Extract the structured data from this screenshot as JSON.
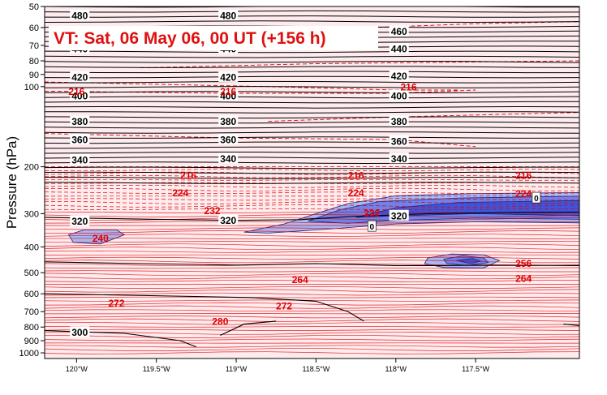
{
  "chart_data": {
    "type": "contour",
    "title": "VT:  Sat, 06 May 06, 00 UT (+156 h)",
    "ylabel": "Pressure (hPa)",
    "xlabel": "",
    "y_scale": "log",
    "y_inverted": true,
    "ylim": [
      50,
      1050
    ],
    "xlim": [
      -120.2,
      -116.85
    ],
    "y_ticks": [
      50,
      60,
      70,
      80,
      90,
      100,
      200,
      300,
      400,
      500,
      600,
      700,
      800,
      900,
      1000
    ],
    "x_ticks": [
      {
        "value": -120.0,
        "label": "120°W"
      },
      {
        "value": -119.5,
        "label": "119.5°W"
      },
      {
        "value": -119.0,
        "label": "119°W"
      },
      {
        "value": -118.5,
        "label": "118.5°W"
      },
      {
        "value": -118.0,
        "label": "118°W"
      },
      {
        "value": -117.5,
        "label": "117.5°W"
      }
    ],
    "theta_labels": [
      {
        "text": "480",
        "x": -119.98,
        "p": 54
      },
      {
        "text": "480",
        "x": -119.05,
        "p": 54
      },
      {
        "text": "460",
        "x": -117.98,
        "p": 62
      },
      {
        "text": "440",
        "x": -119.98,
        "p": 72
      },
      {
        "text": "440",
        "x": -119.05,
        "p": 72
      },
      {
        "text": "440",
        "x": -117.98,
        "p": 72
      },
      {
        "text": "420",
        "x": -119.98,
        "p": 92
      },
      {
        "text": "420",
        "x": -119.05,
        "p": 92
      },
      {
        "text": "420",
        "x": -117.98,
        "p": 91
      },
      {
        "text": "400",
        "x": -119.98,
        "p": 108
      },
      {
        "text": "400",
        "x": -119.05,
        "p": 108
      },
      {
        "text": "400",
        "x": -117.98,
        "p": 108
      },
      {
        "text": "380",
        "x": -119.98,
        "p": 135
      },
      {
        "text": "380",
        "x": -119.05,
        "p": 135
      },
      {
        "text": "380",
        "x": -117.98,
        "p": 135
      },
      {
        "text": "360",
        "x": -119.98,
        "p": 158
      },
      {
        "text": "360",
        "x": -119.05,
        "p": 158
      },
      {
        "text": "360",
        "x": -117.98,
        "p": 160
      },
      {
        "text": "340",
        "x": -119.98,
        "p": 188
      },
      {
        "text": "340",
        "x": -119.05,
        "p": 186
      },
      {
        "text": "340",
        "x": -117.98,
        "p": 186
      },
      {
        "text": "320",
        "x": -119.98,
        "p": 320
      },
      {
        "text": "320",
        "x": -119.05,
        "p": 318
      },
      {
        "text": "320",
        "x": -117.98,
        "p": 305
      },
      {
        "text": "300",
        "x": -119.98,
        "p": 835
      }
    ],
    "temp_labels": [
      {
        "text": "216",
        "x": -120.0,
        "p": 104
      },
      {
        "text": "216",
        "x": -119.05,
        "p": 104
      },
      {
        "text": "216",
        "x": -117.92,
        "p": 100
      },
      {
        "text": "216",
        "x": -119.3,
        "p": 215
      },
      {
        "text": "216",
        "x": -118.25,
        "p": 215
      },
      {
        "text": "216",
        "x": -117.2,
        "p": 215
      },
      {
        "text": "224",
        "x": -119.35,
        "p": 250
      },
      {
        "text": "224",
        "x": -118.25,
        "p": 250
      },
      {
        "text": "224",
        "x": -117.2,
        "p": 252
      },
      {
        "text": "232",
        "x": -119.15,
        "p": 292
      },
      {
        "text": "232",
        "x": -118.15,
        "p": 298
      },
      {
        "text": "240",
        "x": -119.85,
        "p": 370
      },
      {
        "text": "256",
        "x": -117.2,
        "p": 460
      },
      {
        "text": "264",
        "x": -118.6,
        "p": 530
      },
      {
        "text": "264",
        "x": -117.2,
        "p": 525
      },
      {
        "text": "272",
        "x": -119.75,
        "p": 650
      },
      {
        "text": "272",
        "x": -118.7,
        "p": 665
      },
      {
        "text": "280",
        "x": -119.1,
        "p": 760
      }
    ],
    "zero_labels": [
      {
        "text": "0",
        "x": -117.12,
        "p": 262
      },
      {
        "text": "0",
        "x": -118.15,
        "p": 335
      }
    ],
    "terrain": [
      {
        "x": -120.2,
        "p": 1050
      },
      {
        "x": -120.2,
        "p": 1005
      },
      {
        "x": -119.6,
        "p": 990
      },
      {
        "x": -119.4,
        "p": 960
      },
      {
        "x": -119.0,
        "p": 860
      },
      {
        "x": -118.8,
        "p": 775
      },
      {
        "x": -118.5,
        "p": 742
      },
      {
        "x": -118.3,
        "p": 790
      },
      {
        "x": -118.0,
        "p": 860
      },
      {
        "x": -117.5,
        "p": 888
      },
      {
        "x": -117.2,
        "p": 910
      },
      {
        "x": -116.85,
        "p": 945
      },
      {
        "x": -116.85,
        "p": 1050
      }
    ],
    "wind_shading": [
      {
        "level": 1,
        "poly": [
          [
            -118.95,
            352
          ],
          [
            -118.7,
            328
          ],
          [
            -118.5,
            300
          ],
          [
            -118.3,
            275
          ],
          [
            -118.0,
            257
          ],
          [
            -117.5,
            252
          ],
          [
            -116.85,
            250
          ],
          [
            -116.85,
            325
          ],
          [
            -117.5,
            322
          ],
          [
            -118.0,
            328
          ],
          [
            -118.4,
            342
          ],
          [
            -118.8,
            355
          ]
        ]
      },
      {
        "level": 2,
        "poly": [
          [
            -118.55,
            320
          ],
          [
            -118.35,
            290
          ],
          [
            -118.1,
            270
          ],
          [
            -117.6,
            262
          ],
          [
            -116.85,
            258
          ],
          [
            -116.85,
            315
          ],
          [
            -117.5,
            312
          ],
          [
            -118.0,
            318
          ],
          [
            -118.3,
            326
          ]
        ]
      },
      {
        "level": 3,
        "poly": [
          [
            -118.25,
            310
          ],
          [
            -118.0,
            285
          ],
          [
            -117.6,
            272
          ],
          [
            -116.85,
            268
          ],
          [
            -116.85,
            305
          ],
          [
            -117.5,
            300
          ],
          [
            -118.0,
            306
          ]
        ]
      },
      {
        "level": 1,
        "poly": [
          [
            -120.05,
            360
          ],
          [
            -119.95,
            345
          ],
          [
            -119.75,
            345
          ],
          [
            -119.7,
            360
          ],
          [
            -119.85,
            390
          ],
          [
            -120.02,
            385
          ]
        ]
      },
      {
        "level": 1,
        "poly": [
          [
            -117.8,
            440
          ],
          [
            -117.65,
            425
          ],
          [
            -117.45,
            428
          ],
          [
            -117.35,
            450
          ],
          [
            -117.45,
            480
          ],
          [
            -117.7,
            478
          ],
          [
            -117.82,
            462
          ]
        ]
      },
      {
        "level": 2,
        "poly": [
          [
            -117.7,
            445
          ],
          [
            -117.58,
            432
          ],
          [
            -117.45,
            440
          ],
          [
            -117.42,
            458
          ],
          [
            -117.55,
            470
          ],
          [
            -117.68,
            462
          ]
        ]
      },
      {
        "level": 3,
        "poly": [
          [
            -117.62,
            450
          ],
          [
            -117.52,
            442
          ],
          [
            -117.47,
            452
          ],
          [
            -117.53,
            462
          ]
        ]
      }
    ],
    "theta_lines": {
      "upper_start_p": 50,
      "upper_end_p": 230,
      "upper_count": 36,
      "lower": [
        {
          "pts": [
            [
              -120.2,
              310
            ],
            [
              -119.5,
              315
            ],
            [
              -119.0,
              318
            ],
            [
              -118.6,
              316
            ],
            [
              -118.3,
              308
            ],
            [
              -117.8,
              300
            ],
            [
              -117.3,
              297
            ],
            [
              -116.85,
              296
            ]
          ]
        },
        {
          "pts": [
            [
              -120.2,
              455
            ],
            [
              -119.6,
              462
            ],
            [
              -119.0,
              468
            ],
            [
              -118.5,
              462
            ],
            [
              -118.0,
              470
            ],
            [
              -117.7,
              470
            ],
            [
              -117.4,
              468
            ],
            [
              -116.85,
              470
            ]
          ]
        },
        {
          "pts": [
            [
              -120.2,
              600
            ],
            [
              -119.4,
              612
            ],
            [
              -118.9,
              620
            ],
            [
              -118.5,
              640
            ],
            [
              -118.3,
              700
            ],
            [
              -118.2,
              760
            ]
          ]
        },
        {
          "pts": [
            [
              -120.2,
              825
            ],
            [
              -119.7,
              845
            ],
            [
              -119.35,
              900
            ],
            [
              -119.25,
              950
            ]
          ]
        },
        {
          "pts": [
            [
              -119.1,
              860
            ],
            [
              -118.95,
              780
            ],
            [
              -118.75,
              760
            ]
          ]
        },
        {
          "pts": [
            [
              -116.95,
              780
            ],
            [
              -116.85,
              790
            ]
          ]
        }
      ]
    },
    "temp_lines": {
      "upper": [
        {
          "pts": [
            [
              -120.2,
              96
            ],
            [
              -118.8,
              100
            ],
            [
              -118.0,
              103
            ],
            [
              -117.6,
              103
            ]
          ]
        },
        {
          "pts": [
            [
              -120.2,
              104
            ],
            [
              -119.0,
              106
            ],
            [
              -118.0,
              106
            ],
            [
              -117.5,
              103
            ]
          ]
        },
        {
          "pts": [
            [
              -119.6,
              85
            ],
            [
              -118.5,
              82
            ],
            [
              -116.85,
              80
            ]
          ]
        },
        {
          "pts": [
            [
              -118.8,
              62
            ],
            [
              -117.5,
              58
            ],
            [
              -116.85,
              57
            ]
          ]
        },
        {
          "pts": [
            [
              -120.2,
              150
            ],
            [
              -119.0,
              156
            ],
            [
              -118.0,
              158
            ],
            [
              -117.5,
              168
            ]
          ]
        },
        {
          "pts": [
            [
              -118.8,
              135
            ],
            [
              -118.0,
              130
            ],
            [
              -116.85,
              125
            ]
          ]
        }
      ],
      "dense_start_p": 200,
      "dense_end_p": 1000,
      "dense_count": 58
    },
    "colors": {
      "background": "#ffffff",
      "plot_fill": "#fdebee",
      "terrain": "#00f0ff",
      "theta": "#000000",
      "temperature": "#e00000",
      "wind_levels": [
        "#a9b7f2",
        "#6e82ea",
        "#3c55dd",
        "#1b2fb8"
      ]
    }
  }
}
